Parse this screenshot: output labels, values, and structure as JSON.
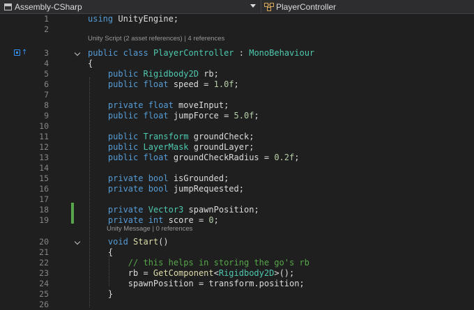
{
  "toolbar": {
    "project_dropdown": "Assembly-CSharp",
    "class_dropdown": "PlayerController"
  },
  "codelens": {
    "class_lens": "Unity Script (2 asset references) | 4 references",
    "start_lens": "Unity Message | 0 references"
  },
  "editor": {
    "lines": [
      {
        "n": "1",
        "tokens": [
          [
            "k",
            "using"
          ],
          [
            "id",
            " UnityEngine;"
          ]
        ]
      },
      {
        "n": "2",
        "tokens": []
      },
      {
        "n": "3",
        "tokens": [
          [
            "k",
            "public class"
          ],
          [
            "id",
            " "
          ],
          [
            "t",
            "PlayerController"
          ],
          [
            "id",
            " : "
          ],
          [
            "t",
            "MonoBehaviour"
          ]
        ]
      },
      {
        "n": "4",
        "tokens": [
          [
            "id",
            "{"
          ]
        ]
      },
      {
        "n": "5",
        "tokens": [
          [
            "id",
            "    "
          ],
          [
            "k",
            "public"
          ],
          [
            "id",
            " "
          ],
          [
            "t",
            "Rigidbody2D"
          ],
          [
            "id",
            " rb;"
          ]
        ]
      },
      {
        "n": "6",
        "tokens": [
          [
            "id",
            "    "
          ],
          [
            "k",
            "public float"
          ],
          [
            "id",
            " speed = "
          ],
          [
            "n",
            "1.0f"
          ],
          [
            "id",
            ";"
          ]
        ]
      },
      {
        "n": "7",
        "tokens": []
      },
      {
        "n": "8",
        "tokens": [
          [
            "id",
            "    "
          ],
          [
            "k",
            "private float"
          ],
          [
            "id",
            " moveInput;"
          ]
        ]
      },
      {
        "n": "9",
        "tokens": [
          [
            "id",
            "    "
          ],
          [
            "k",
            "public float"
          ],
          [
            "id",
            " jumpForce = "
          ],
          [
            "n",
            "5.0f"
          ],
          [
            "id",
            ";"
          ]
        ]
      },
      {
        "n": "10",
        "tokens": []
      },
      {
        "n": "11",
        "tokens": [
          [
            "id",
            "    "
          ],
          [
            "k",
            "public"
          ],
          [
            "id",
            " "
          ],
          [
            "t",
            "Transform"
          ],
          [
            "id",
            " groundCheck;"
          ]
        ]
      },
      {
        "n": "12",
        "tokens": [
          [
            "id",
            "    "
          ],
          [
            "k",
            "public"
          ],
          [
            "id",
            " "
          ],
          [
            "t",
            "LayerMask"
          ],
          [
            "id",
            " groundLayer;"
          ]
        ]
      },
      {
        "n": "13",
        "tokens": [
          [
            "id",
            "    "
          ],
          [
            "k",
            "public float"
          ],
          [
            "id",
            " groundCheckRadius = "
          ],
          [
            "n",
            "0.2f"
          ],
          [
            "id",
            ";"
          ]
        ]
      },
      {
        "n": "14",
        "tokens": []
      },
      {
        "n": "15",
        "tokens": [
          [
            "id",
            "    "
          ],
          [
            "k",
            "private bool"
          ],
          [
            "id",
            " isGrounded;"
          ]
        ]
      },
      {
        "n": "16",
        "tokens": [
          [
            "id",
            "    "
          ],
          [
            "k",
            "private bool"
          ],
          [
            "id",
            " jumpRequested;"
          ]
        ]
      },
      {
        "n": "17",
        "tokens": []
      },
      {
        "n": "18",
        "tokens": [
          [
            "id",
            "    "
          ],
          [
            "k",
            "private"
          ],
          [
            "id",
            " "
          ],
          [
            "t",
            "Vector3"
          ],
          [
            "id",
            " spawnPosition;"
          ]
        ]
      },
      {
        "n": "19",
        "tokens": [
          [
            "id",
            "    "
          ],
          [
            "k",
            "private int"
          ],
          [
            "id",
            " score = "
          ],
          [
            "n",
            "0"
          ],
          [
            "id",
            ";"
          ]
        ]
      },
      {
        "n": "20",
        "tokens": [
          [
            "id",
            "    "
          ],
          [
            "k",
            "void"
          ],
          [
            "id",
            " "
          ],
          [
            "m",
            "Start"
          ],
          [
            "id",
            "()"
          ]
        ]
      },
      {
        "n": "21",
        "tokens": [
          [
            "id",
            "    {"
          ]
        ]
      },
      {
        "n": "22",
        "tokens": [
          [
            "id",
            "        "
          ],
          [
            "c",
            "// this helps in storing the go's rb"
          ]
        ]
      },
      {
        "n": "23",
        "tokens": [
          [
            "id",
            "        rb = "
          ],
          [
            "m",
            "GetComponent"
          ],
          [
            "id",
            "<"
          ],
          [
            "t",
            "Rigidbody2D"
          ],
          [
            "id",
            ">();"
          ]
        ]
      },
      {
        "n": "24",
        "tokens": [
          [
            "id",
            "        spawnPosition = transform.position;"
          ]
        ]
      },
      {
        "n": "25",
        "tokens": [
          [
            "id",
            "    }"
          ]
        ]
      },
      {
        "n": "26",
        "tokens": []
      }
    ]
  }
}
